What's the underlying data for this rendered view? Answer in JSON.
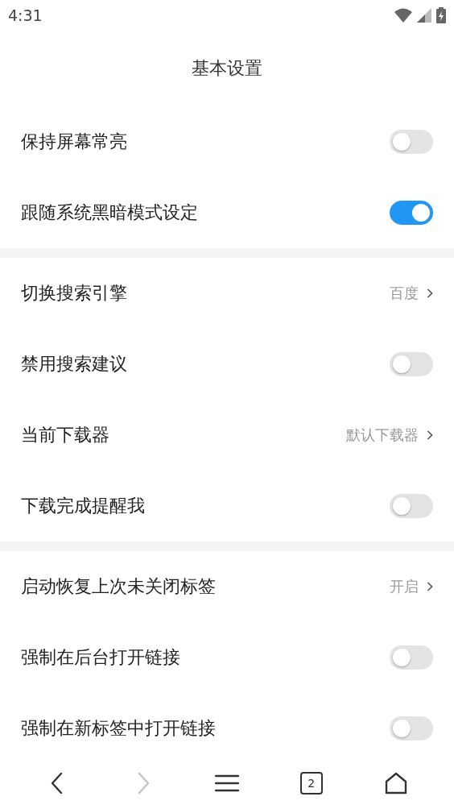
{
  "status_bar": {
    "time": "4:31"
  },
  "title": "基本设置",
  "sections": [
    {
      "items": [
        {
          "kind": "toggle",
          "label": "保持屏幕常亮",
          "on": false
        },
        {
          "kind": "toggle",
          "label": "跟随系统黑暗模式设定",
          "on": true
        }
      ]
    },
    {
      "items": [
        {
          "kind": "link",
          "label": "切换搜索引擎",
          "value": "百度"
        },
        {
          "kind": "toggle",
          "label": "禁用搜索建议",
          "on": false
        },
        {
          "kind": "link",
          "label": "当前下载器",
          "value": "默认下载器"
        },
        {
          "kind": "toggle",
          "label": "下载完成提醒我",
          "on": false
        }
      ]
    },
    {
      "items": [
        {
          "kind": "link",
          "label": "启动恢复上次未关闭标签",
          "value": "开启"
        },
        {
          "kind": "toggle",
          "label": "强制在后台打开链接",
          "on": false
        },
        {
          "kind": "toggle",
          "label": "强制在新标签中打开链接",
          "on": false
        }
      ]
    }
  ],
  "nav": [
    {
      "kind": "back",
      "disabled": false
    },
    {
      "kind": "forward",
      "disabled": true
    },
    {
      "kind": "menu",
      "disabled": false
    },
    {
      "kind": "tabs",
      "count": "2",
      "disabled": false
    },
    {
      "kind": "home",
      "disabled": false
    }
  ]
}
